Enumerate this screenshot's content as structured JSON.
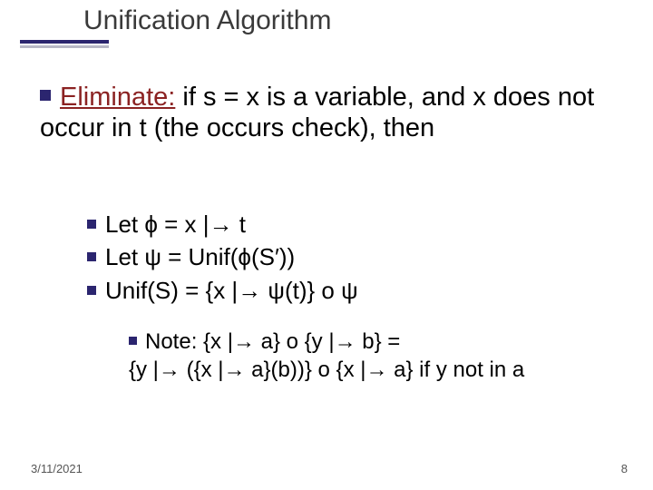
{
  "title": "Unification Algorithm",
  "main": {
    "eliminate_word": "Eliminate:",
    "rest": " if s = x is a variable, and x does not occur in t (the occurs check), then"
  },
  "subs": {
    "a": "Let ϕ = x |→ t",
    "b": "Let ψ = Unif(ϕ(S′))",
    "c": "Unif(S) = {x |→ ψ(t)} o ψ"
  },
  "note": {
    "line1": "Note: {x |→ a} o {y |→ b} =",
    "line2": "{y |→ ({x |→ a}(b))} o {x |→ a} if y not in a"
  },
  "footer": {
    "date": "3/11/2021",
    "page": "8"
  }
}
